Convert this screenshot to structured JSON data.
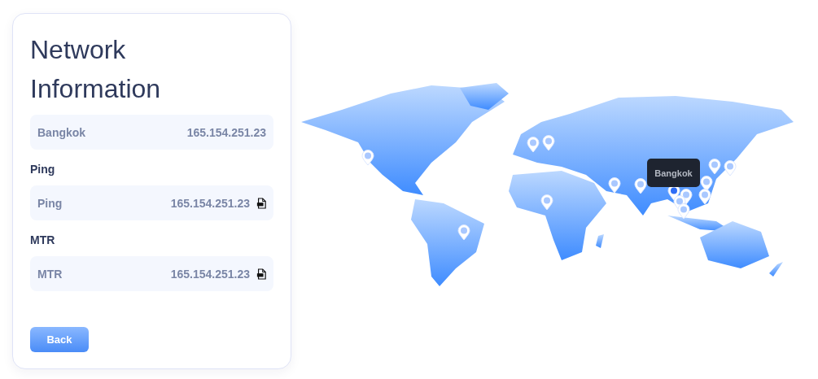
{
  "title": "Network Information",
  "location": {
    "label": "Bangkok",
    "value": "165.154.251.23"
  },
  "sections": [
    {
      "heading": "Ping",
      "label": "Ping",
      "value": "165.154.251.23"
    },
    {
      "heading": "MTR",
      "label": "MTR",
      "value": "165.154.251.23"
    }
  ],
  "back_button": "Back",
  "map": {
    "tooltip": "Bangkok",
    "pins": [
      {
        "selected": false
      },
      {
        "selected": false
      },
      {
        "selected": false
      },
      {
        "selected": false
      },
      {
        "selected": false
      },
      {
        "selected": false
      },
      {
        "selected": false
      },
      {
        "selected": false
      },
      {
        "selected": false
      },
      {
        "selected": true
      },
      {
        "selected": false
      },
      {
        "selected": false
      },
      {
        "selected": false
      },
      {
        "selected": false
      },
      {
        "selected": false
      }
    ]
  }
}
